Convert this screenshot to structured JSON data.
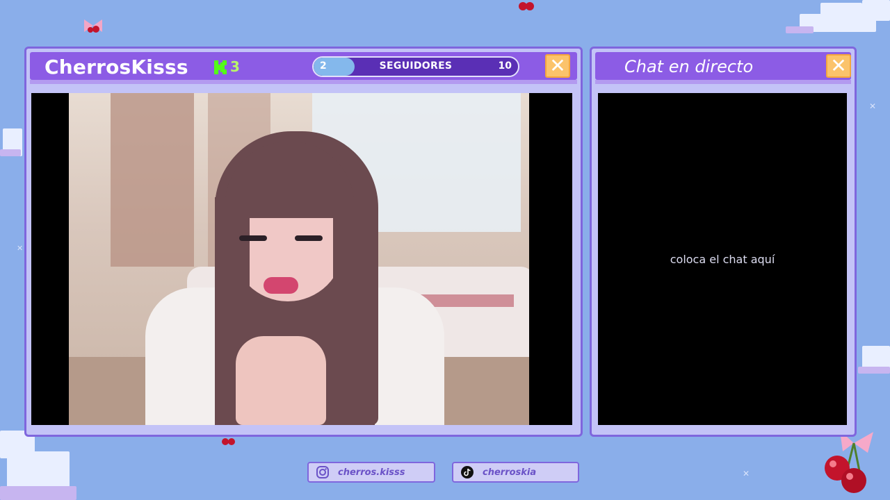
{
  "stream": {
    "channel_name": "CherrosKisss",
    "platform_icon": "kick-icon",
    "viewer_count": "3",
    "follower_goal": {
      "current": "2",
      "label": "SEGUIDORES",
      "goal": "10",
      "progress_fraction": 0.2
    },
    "close_label": "✕"
  },
  "chat": {
    "title": "Chat en directo",
    "placeholder": "coloca el chat aquí",
    "close_label": "✕"
  },
  "socials": [
    {
      "icon": "instagram-icon",
      "handle": "cherros.kisss"
    },
    {
      "icon": "tiktok-icon",
      "handle": "cherroskia"
    }
  ],
  "colors": {
    "background": "#8aaeea",
    "panel": "#c3c3f7",
    "titlebar": "#8c5ce5",
    "close_button": "#fbc36b",
    "kick_green": "#53fc18"
  }
}
